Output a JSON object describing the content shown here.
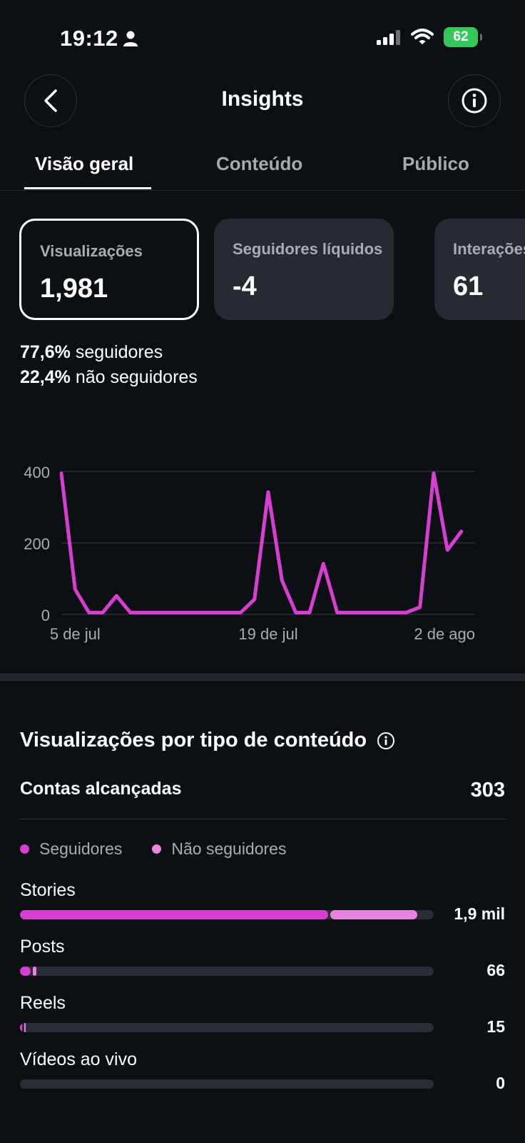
{
  "status_bar": {
    "time": "19:12",
    "battery": "62"
  },
  "header": {
    "title": "Insights"
  },
  "tabs": [
    {
      "label": "Visão geral",
      "active": true
    },
    {
      "label": "Conteúdo",
      "active": false
    },
    {
      "label": "Público",
      "active": false
    }
  ],
  "metrics": [
    {
      "label": "Visualizações",
      "value": "1,981"
    },
    {
      "label": "Seguidores líquidos",
      "value": "-4"
    },
    {
      "label": "Interações",
      "value": "61"
    }
  ],
  "split": {
    "followers_pct": "77,6%",
    "followers_label": "seguidores",
    "non_followers_pct": "22,4%",
    "non_followers_label": "não seguidores"
  },
  "chart_data": {
    "type": "line",
    "x": [
      "4 de jul",
      "5 de jul",
      "6 de jul",
      "7 de jul",
      "8 de jul",
      "9 de jul",
      "10 de jul",
      "11 de jul",
      "12 de jul",
      "13 de jul",
      "14 de jul",
      "15 de jul",
      "16 de jul",
      "17 de jul",
      "18 de jul",
      "19 de jul",
      "20 de jul",
      "21 de jul",
      "22 de jul",
      "23 de jul",
      "24 de jul",
      "25 de jul",
      "26 de jul",
      "27 de jul",
      "28 de jul",
      "29 de jul",
      "30 de jul",
      "31 de jul",
      "1 de ago",
      "2 de ago",
      "3 de ago"
    ],
    "series": [
      {
        "values": [
          395,
          70,
          5,
          5,
          52,
          5,
          5,
          5,
          5,
          5,
          5,
          5,
          5,
          5,
          42,
          342,
          95,
          5,
          5,
          142,
          5,
          5,
          5,
          5,
          5,
          5,
          20,
          395,
          180,
          232
        ]
      }
    ],
    "x_ticks": [
      "5 de jul",
      "19 de jul",
      "2 de ago"
    ],
    "y_ticks": [
      0,
      200,
      400
    ],
    "ylim": [
      0,
      400
    ],
    "grid": true,
    "color": "#d73fd1"
  },
  "content_section": {
    "title": "Visualizações por tipo de conteúdo",
    "reached_label": "Contas alcançadas",
    "reached_value": "303",
    "legend": [
      {
        "label": "Seguidores",
        "color": "#d73fd1"
      },
      {
        "label": "Não seguidores",
        "color": "#e884e0"
      }
    ],
    "types": [
      {
        "label": "Stories",
        "value": "1,9 mil",
        "followers_frac": 0.745,
        "non_followers_frac": 0.21
      },
      {
        "label": "Posts",
        "value": "66",
        "followers_frac": 0.026,
        "non_followers_frac": 0.008
      },
      {
        "label": "Reels",
        "value": "15",
        "followers_frac": 0.006,
        "non_followers_frac": 0.002
      },
      {
        "label": "Vídeos ao vivo",
        "value": "0",
        "followers_frac": 0,
        "non_followers_frac": 0
      }
    ]
  }
}
